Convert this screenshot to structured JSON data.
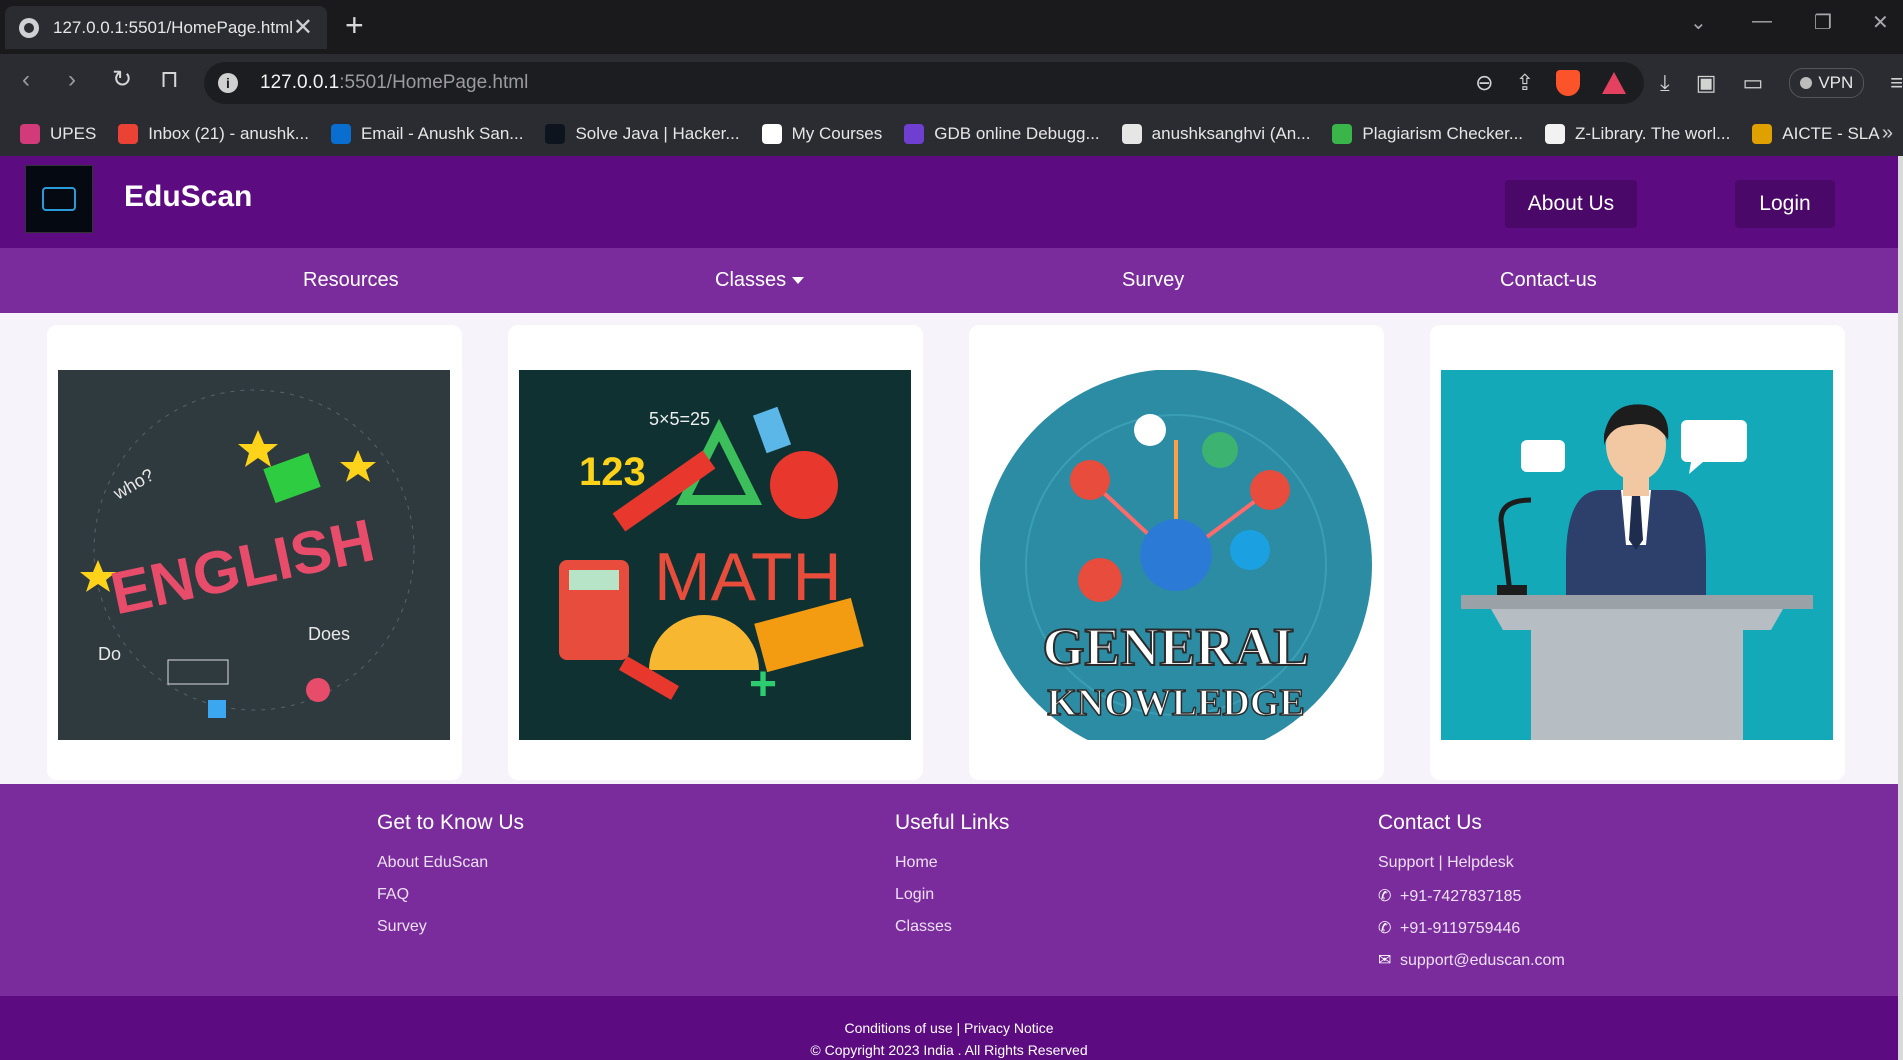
{
  "browser": {
    "tab_title": "127.0.0.1:5501/HomePage.html",
    "tab_close": "✕",
    "new_tab": "+",
    "url_host": "127.0.0.1",
    "url_rest": ":5501/HomePage.html",
    "vpn_label": "VPN",
    "bookmarks": [
      {
        "label": "UPES",
        "color": "#d23a7a"
      },
      {
        "label": "Inbox (21) - anushk...",
        "color": "#ea4335"
      },
      {
        "label": "Email - Anushk San...",
        "color": "#0a6ed1"
      },
      {
        "label": "Solve Java | Hacker...",
        "color": "#0e141e"
      },
      {
        "label": "My Courses",
        "color": "#ffffff"
      },
      {
        "label": "GDB online Debugg...",
        "color": "#6e3fd1"
      },
      {
        "label": "anushksanghvi (An...",
        "color": "#e6e6e6"
      },
      {
        "label": "Plagiarism Checker...",
        "color": "#39b54a"
      },
      {
        "label": "Z-Library. The worl...",
        "color": "#f2f2f2"
      },
      {
        "label": "AICTE - SLA",
        "color": "#e0a000"
      }
    ]
  },
  "site": {
    "brand": "EduScan",
    "about_button": "About Us",
    "login_button": "Login",
    "nav": [
      "Resources",
      "Classes",
      "Survey",
      "Contact-us"
    ],
    "cards": [
      "English",
      "Math",
      "General Knowledge",
      "Speaker"
    ],
    "card_art": {
      "english_word": "ENGLISH",
      "math_word": "MATH",
      "gk_line1": "GENERAL",
      "gk_line2": "KNOWLEDGE"
    },
    "footer": {
      "col1_title": "Get to Know Us",
      "col1_links": [
        "About EduScan",
        "FAQ",
        "Survey"
      ],
      "col2_title": "Useful Links",
      "col2_links": [
        "Home",
        "Login",
        "Classes"
      ],
      "col3_title": "Contact Us",
      "col3_support": "Support | Helpdesk",
      "phone1": "+91-7427837185",
      "phone2": "+91-9119759446",
      "email": "support@eduscan.com"
    },
    "legal_links": "Conditions of use | Privacy Notice",
    "copyright": "© Copyright 2023 India . All Rights Reserved"
  }
}
